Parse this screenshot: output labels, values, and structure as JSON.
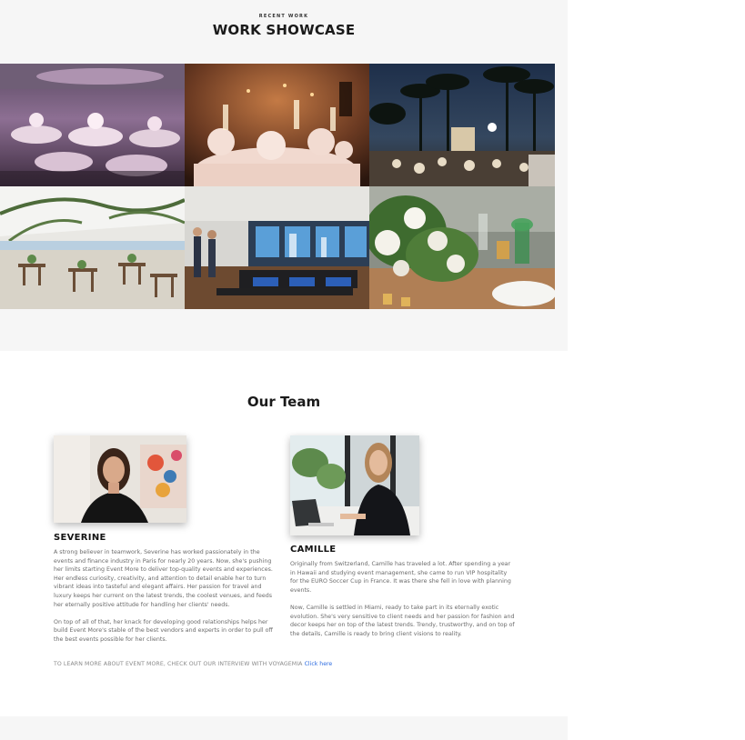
{
  "showcase": {
    "eyebrow": "RECENT WORK",
    "title": "WORK SHOWCASE",
    "images": [
      {
        "icon": "ballroom-event-photo"
      },
      {
        "icon": "candlelit-table-photo"
      },
      {
        "icon": "palm-night-event-photo"
      },
      {
        "icon": "tent-beach-event-photo"
      },
      {
        "icon": "vip-lounge-photo"
      },
      {
        "icon": "floral-tablescape-photo"
      }
    ]
  },
  "team": {
    "title": "Our Team",
    "members": [
      {
        "name": "SEVERINE",
        "bio": [
          "A strong believer in teamwork, Severine has worked passionately in the events and finance industry in Paris for nearly 20 years. Now, she's pushing her limits starting Event More to deliver top-quality events and experiences. Her endless curiosity, creativity, and attention to detail enable her to turn vibrant ideas into tasteful and elegant affairs. Her passion for travel and luxury keeps her current on the latest trends, the coolest venues, and feeds her eternally positive attitude for handling her clients' needs.",
          "On top of all of that, her knack for developing good relationships helps her build Event More's stable of the best vendors and experts in order to pull off the best events possible for her clients."
        ]
      },
      {
        "name": "CAMILLE",
        "bio": [
          "Originally from Switzerland, Camille has traveled a lot. After spending a year in Hawaii and studying event management, she came to run VIP hospitality for the EURO Soccer Cup in France. It was there she fell in love with planning events.",
          "Now, Camille is settled in Miami, ready to take part in its eternally exotic evolution. She's very sensitive to client needs and her passion for fashion and decor keeps her on top of the latest trends. Trendy, trustworthy, and on top of the details, Camille is ready to bring client visions to reality."
        ]
      }
    ],
    "interview_text": "TO LEARN MORE ABOUT EVENT MORE, CHECK OUT OUR INTERVIEW WITH VOYAGEMIA",
    "interview_link": "Click here"
  }
}
